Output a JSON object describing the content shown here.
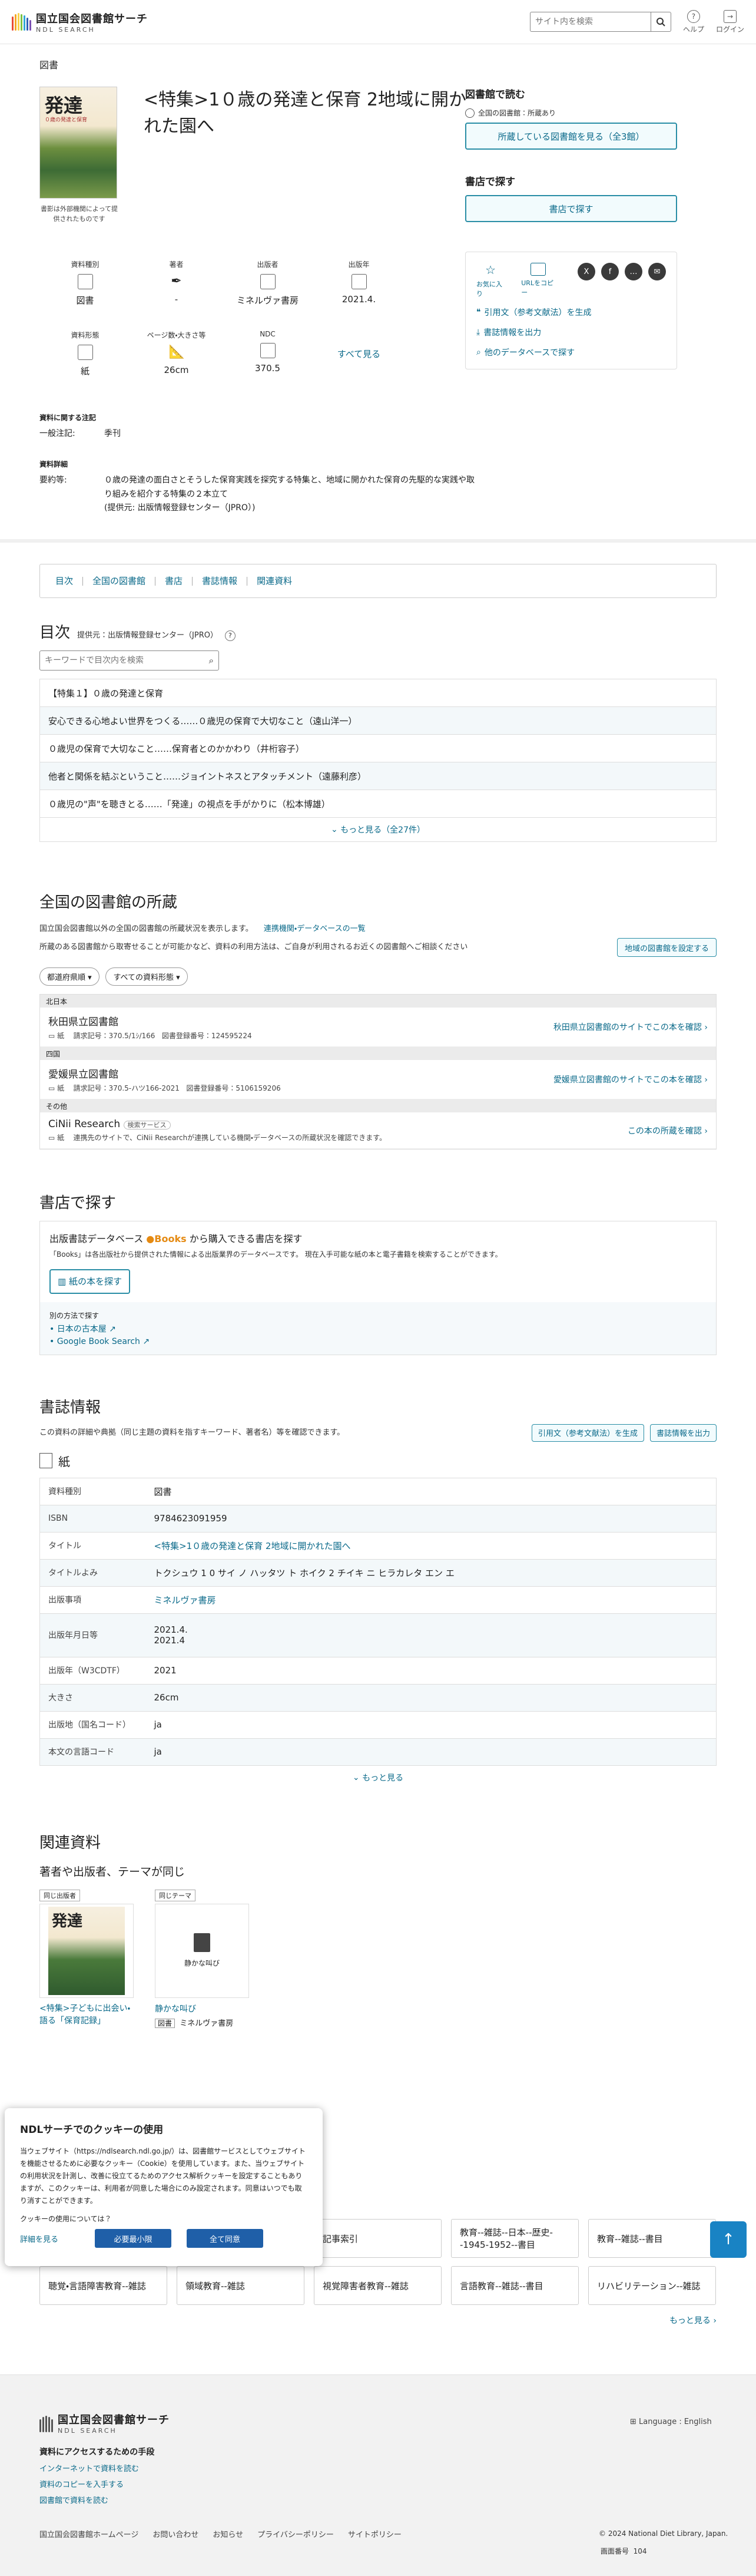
{
  "header": {
    "logo_jp": "国立国会図書館サーチ",
    "logo_en": "NDL SEARCH",
    "search_placeholder": "サイト内を検索",
    "help": "ヘルプ",
    "login": "ログイン",
    "logo_colors": [
      "#e94b35",
      "#f5a623",
      "#f8d24a",
      "#7cc242",
      "#2fa7d6",
      "#2d5fb5",
      "#7b4fb3"
    ]
  },
  "breadcrumb": "図書",
  "book": {
    "title": "<特集>1０歳の発達と保育 2地域に開かれた園へ",
    "cover_big": "発達",
    "cover_sub": "０歳の発達と保育",
    "cover_note": "書影は外部機関によって提供されたものです",
    "meta": [
      {
        "label": "資料種別",
        "value": "図書",
        "icon": "document-icon"
      },
      {
        "label": "著者",
        "value": "-",
        "icon": "pen-icon"
      },
      {
        "label": "出版者",
        "value": "ミネルヴァ書房",
        "icon": "building-icon"
      },
      {
        "label": "出版年",
        "value": "2021.4.",
        "icon": "calendar-icon"
      },
      {
        "label": "資料形態",
        "value": "紙",
        "icon": "paper-icon"
      },
      {
        "label": "ページ数・大きさ等",
        "value": "26cm",
        "icon": "ruler-icon"
      },
      {
        "label": "NDC",
        "value": "370.5",
        "icon": "ndc-icon"
      }
    ],
    "see_all": "すべて見る"
  },
  "notes": {
    "heading1": "資料に関する注記",
    "general_label": "一般注記:",
    "general_value": "季刊",
    "heading2": "資料詳細",
    "summary_label": "要約等:",
    "summary_value": "０歳の発達の面白さとそうした保育実践を探究する特集と、地域に開かれた保育の先駆的な実践や取り組みを紹介する特集の２本立て",
    "summary_source": "(提供元: 出版情報登録センター（JPRO）)"
  },
  "sidebar": {
    "read_heading": "図書館で読む",
    "holding_note": "全国の図書館：所蔵あり",
    "holding_btn": "所蔵している図書館を見る（全3館）",
    "buy_heading": "書店で探す",
    "buy_btn": "書店で探す",
    "favorite": "お気に入り",
    "url_copy": "URLをコピー",
    "sns": [
      "X",
      "f",
      "…",
      "✉"
    ],
    "link_cite": "引用文（参考文献法）を生成",
    "link_export": "書誌情報を出力",
    "link_other": "他のデータベースで探す"
  },
  "tabs": [
    "目次",
    "全国の図書館",
    "書店",
    "書誌情報",
    "関連資料"
  ],
  "toc": {
    "heading": "目次",
    "provider": "提供元：出版情報登録センター（JPRO）",
    "search_placeholder": "キーワードで目次内を検索",
    "items": [
      "【特集１】０歳の発達と保育",
      "安心できる心地よい世界をつくる……０歳児の保育で大切なこと（遠山洋一）",
      "０歳児の保育で大切なこと……保育者とのかかわり（井桁容子）",
      "他者と関係を結ぶということ……ジョイントネスとアタッチメント（遠藤利彦）",
      "０歳児の\"声\"を聴きとる……「発達」の視点を手がかりに（松本博雄）"
    ],
    "more": "もっと見る（全27件）"
  },
  "libraries": {
    "heading": "全国の図書館の所蔵",
    "desc1": "国立国会図書館以外の全国の図書館の所蔵状況を表示します。",
    "desc_link": "連携機関・データベースの一覧",
    "desc2": "所蔵のある図書館から取寄せることが可能かなど、資料の利用方法は、ご自身が利用されるお近くの図書館へご相談ください",
    "setting_btn": "地域の図書館を設定する",
    "filter1": "都道府県順",
    "filter2": "すべての資料形態",
    "groups": [
      {
        "region": "北日本",
        "name": "秋田県立図書館",
        "form": "紙",
        "call": "請求記号：370.5/1ｼ/166",
        "reg": "図書登録番号：124595224",
        "link": "秋田県立図書館のサイトでこの本を確認"
      },
      {
        "region": "四国",
        "name": "愛媛県立図書館",
        "form": "紙",
        "call": "請求記号：370.5-ハツ166-2021",
        "reg": "図書登録番号：5106159206",
        "link": "愛媛県立図書館のサイトでこの本を確認"
      },
      {
        "region": "その他",
        "name": "CiNii Research",
        "badge": "検索サービス",
        "form": "紙",
        "call": "連携先のサイトで、CiNii Researchが連携している機関・データベースの所蔵状況を確認できます。",
        "reg": "",
        "link": "この本の所蔵を確認"
      }
    ]
  },
  "store": {
    "heading": "書店で探す",
    "title_pre": "出版書誌データベース",
    "title_brand": "Books",
    "title_post": "から購入できる書店を探す",
    "desc": "「Books」は各出版社から提供された情報による出版業界のデータベースです。 現在入手可能な紙の本と電子書籍を検索することができます。",
    "btn": "紙の本を探す",
    "other_heading": "別の方法で探す",
    "other_links": [
      "日本の古本屋",
      "Google Book Search"
    ]
  },
  "biblio": {
    "heading": "書誌情報",
    "desc": "この資料の詳細や典拠（同じ主題の資料を指すキーワード、著者名）等を確認できます。",
    "cite_btn": "引用文（参考文献法）を生成",
    "export_btn": "書誌情報を出力",
    "form_title": "紙",
    "rows": [
      {
        "k": "資料種別",
        "v": "図書",
        "link": false
      },
      {
        "k": "ISBN",
        "v": "9784623091959",
        "link": false
      },
      {
        "k": "タイトル",
        "v": "<特集>1０歳の発達と保育 2地域に開かれた園へ",
        "link": true
      },
      {
        "k": "タイトルよみ",
        "v": "トクシュウ 1 0 サイ ノ ハッタツ ト ホイク 2 チイキ ニ ヒラカレタ エン エ",
        "link": false
      },
      {
        "k": "出版事項",
        "v": "ミネルヴァ書房",
        "link": true
      },
      {
        "k": "出版年月日等",
        "v": "2021.4.",
        "v2": "2021.4",
        "link": false
      },
      {
        "k": "出版年（W3CDTF）",
        "v": "2021",
        "link": false
      },
      {
        "k": "大きさ",
        "v": "26cm",
        "link": false
      },
      {
        "k": "出版地（国名コード）",
        "v": "ja",
        "link": false
      },
      {
        "k": "本文の言語コード",
        "v": "ja",
        "link": false
      }
    ],
    "more": "もっと見る"
  },
  "related": {
    "heading": "関連資料",
    "subheading": "著者や出版者、テーマが同じ",
    "cards": [
      {
        "tag": "同じ出版者",
        "title": "<特集>子どもに出会い・語る「保育記録」",
        "type": "",
        "publisher": ""
      },
      {
        "tag": "同じテーマ",
        "title": "静かな叫び",
        "inner": "静かな叫び",
        "type": "図書",
        "publisher": "ミネルヴァ書房"
      }
    ],
    "subjects_row1": [
      "記事索引",
      "教育--雑誌--日本--歴史--1945-1952--書目",
      "教育--雑誌--書目"
    ],
    "subjects_row2": [
      "聴覚・言語障害教育--雑誌",
      "領域教育--雑誌",
      "視覚障害者教育--雑誌",
      "言語教育--雑誌--書目",
      "リハビリテーション--雑誌"
    ],
    "more": "もっと見る"
  },
  "cookie": {
    "title": "NDLサーチでのクッキーの使用",
    "body": "当ウェブサイト（https://ndlsearch.ndl.go.jp/）は、図書館サービスとしてウェブサイトを機能させるために必要なクッキー（Cookie）を使用しています。また、当ウェブサイトの利用状況を計測し、改善に役立てるためのアクセス解析クッキーを設定することもありますが、このクッキーは、利用者が同意した場合にのみ設定されます。同意はいつでも取り消すことができます。",
    "question": "クッキーの使用については？",
    "detail": "詳細を見る",
    "essential_btn": "必要最小限",
    "accept_btn": "全て同意"
  },
  "footer": {
    "logo_jp": "国立国会図書館サーチ",
    "logo_en": "NDL SEARCH",
    "language": "Language : English",
    "access_heading": "資料にアクセスするための手段",
    "access_links": [
      "インターネットで資料を読む",
      "資料のコピーを入手する",
      "図書館で資料を読む"
    ],
    "bottom_links": [
      "国立国会図書館ホームページ",
      "お問い合わせ",
      "お知らせ",
      "プライバシーポリシー",
      "サイトポリシー"
    ],
    "copyright": "© 2024 National Diet Library, Japan.",
    "screen_no_label": "画面番号",
    "screen_no": "104"
  }
}
